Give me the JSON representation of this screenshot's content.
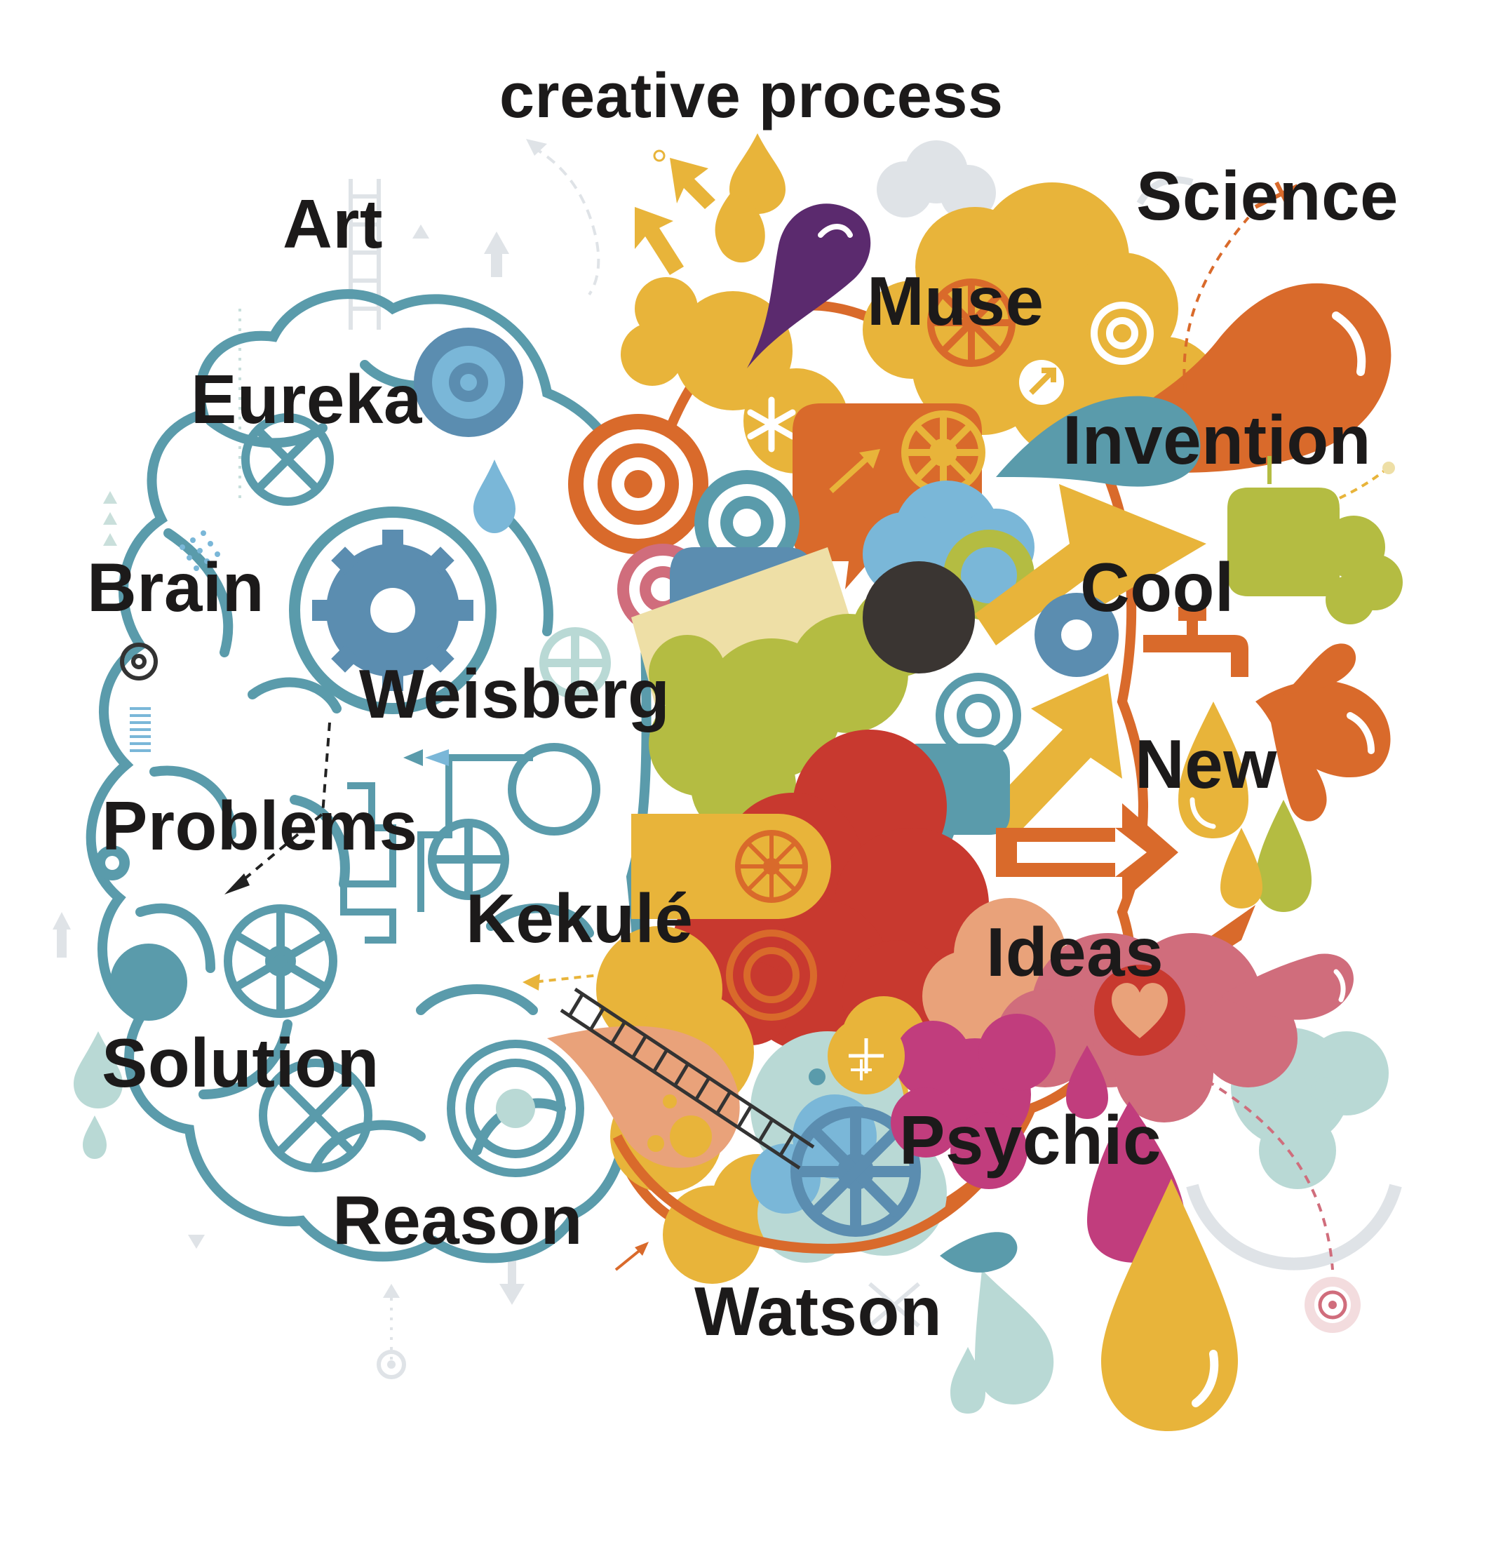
{
  "title": "creative process",
  "words": {
    "art": "Art",
    "science": "Science",
    "muse": "Muse",
    "eureka": "Eureka",
    "invention": "Invention",
    "brain": "Brain",
    "cool": "Cool",
    "weisberg": "Weisberg",
    "new": "New",
    "problems": "Problems",
    "kekule": "Kekulé",
    "ideas": "Ideas",
    "solution": "Solution",
    "psychic": "Psychic",
    "reason": "Reason",
    "watson": "Watson"
  },
  "colors": {
    "text": "#1c1a1a",
    "brain_outline": "#5a9bab",
    "gear_blue": "#5b8db0",
    "orange": "#d96a2b",
    "yellow": "#e8b43a",
    "purple": "#5b2a6e",
    "red": "#c8392f",
    "olive": "#b4bc42",
    "pink": "#d06d7c",
    "magenta": "#c13d7d",
    "light_blue": "#7ab7d8",
    "pale_teal": "#b9d9d5",
    "gray": "#dde2e6"
  },
  "illustration": {
    "left_icons": [
      "gear-icon",
      "wheel-icon",
      "target-icon",
      "arrow-icon",
      "ladder-icon",
      "drop-icon"
    ],
    "right_icons": [
      "drop-icon",
      "cloud-icon",
      "target-icon",
      "arrow-icon",
      "speech-bubble-icon",
      "faucet-icon",
      "heart-icon",
      "wheel-icon"
    ]
  }
}
